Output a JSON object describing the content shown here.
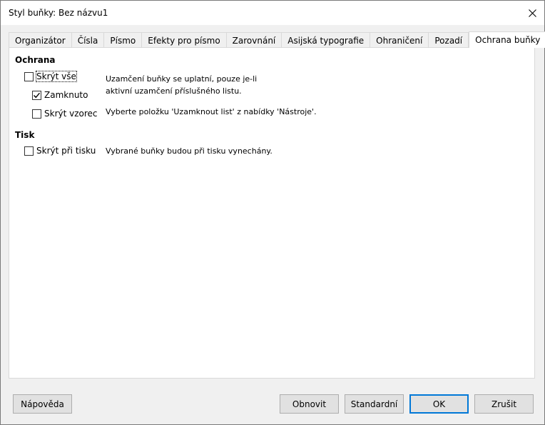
{
  "window": {
    "title": "Styl buňky: Bez názvu1"
  },
  "tabs": [
    {
      "label": "Organizátor",
      "active": false
    },
    {
      "label": "Čísla",
      "active": false
    },
    {
      "label": "Písmo",
      "active": false
    },
    {
      "label": "Efekty pro písmo",
      "active": false
    },
    {
      "label": "Zarovnání",
      "active": false
    },
    {
      "label": "Asijská typografie",
      "active": false
    },
    {
      "label": "Ohraničení",
      "active": false
    },
    {
      "label": "Pozadí",
      "active": false
    },
    {
      "label": "Ochrana buňky",
      "active": true
    }
  ],
  "protection": {
    "heading": "Ochrana",
    "hide_all": {
      "label": "Skrýt vše",
      "checked": false
    },
    "locked": {
      "label": "Zamknuto",
      "checked": true
    },
    "hide_formula": {
      "label": "Skrýt vzorec",
      "checked": false
    },
    "desc_lock": "Uzamčení buňky se uplatní, pouze je-li aktivní uzamčení příslušného listu.",
    "desc_menu": "Vyberte položku 'Uzamknout list' z nabídky 'Nástroje'."
  },
  "print": {
    "heading": "Tisk",
    "hide_print": {
      "label": "Skrýt při tisku",
      "checked": false
    },
    "desc": "Vybrané buňky budou při tisku vynechány."
  },
  "buttons": {
    "help": "Nápověda",
    "reset": "Obnovit",
    "standard": "Standardní",
    "ok": "OK",
    "cancel": "Zrušit"
  },
  "colors": {
    "accent": "#0078d7"
  }
}
